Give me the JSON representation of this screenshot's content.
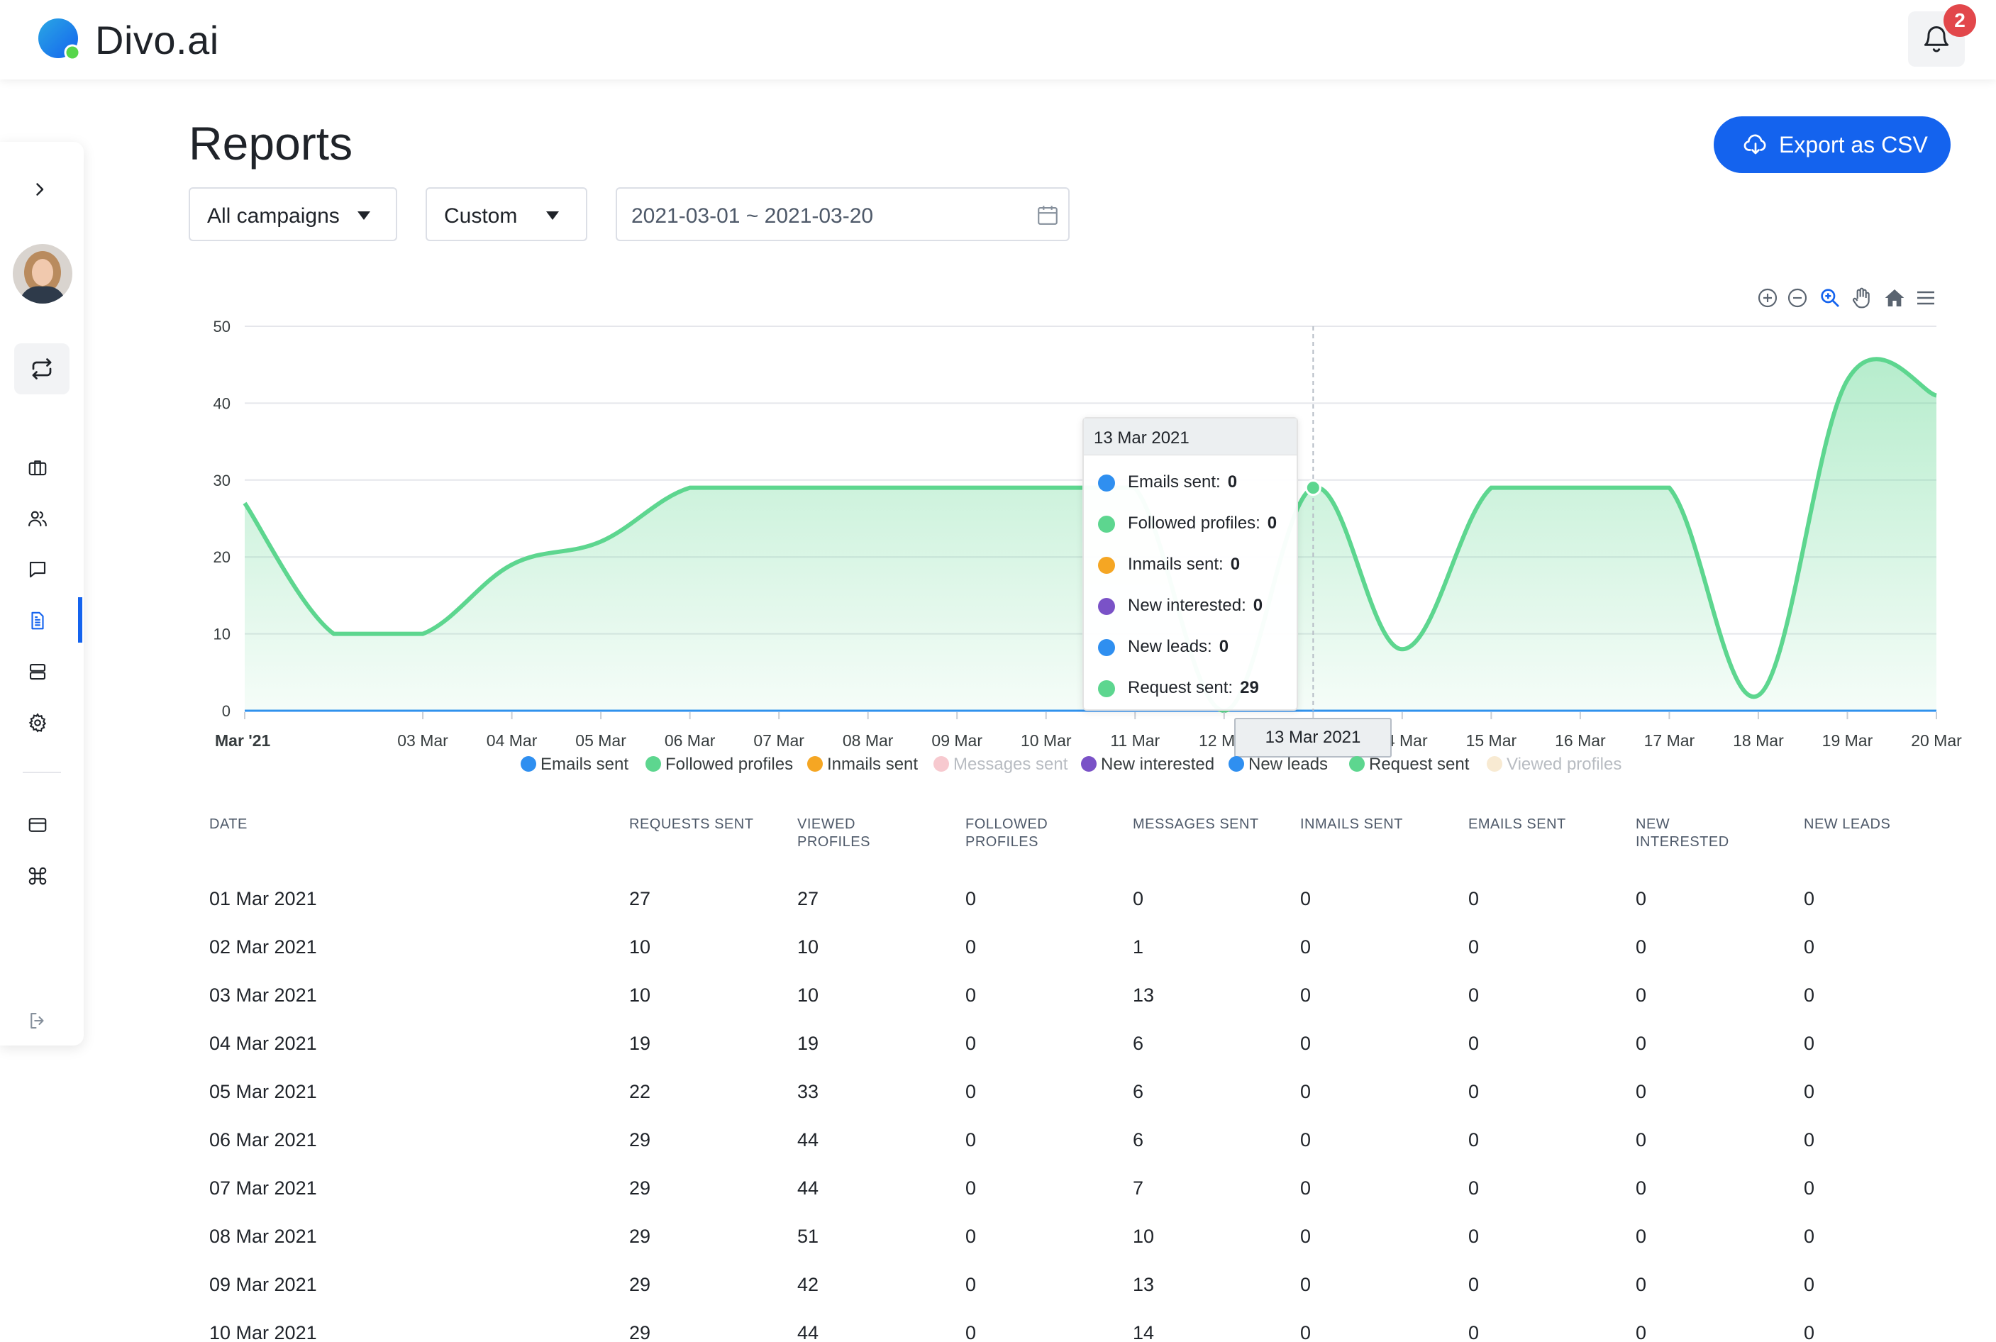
{
  "app": {
    "name": "Divo.ai",
    "notifications": "2"
  },
  "page": {
    "title": "Reports",
    "export_label": "Export as CSV"
  },
  "filters": {
    "campaign": "All campaigns",
    "period": "Custom",
    "date_range": "2021-03-01 ~ 2021-03-20"
  },
  "colors": {
    "accent": "#1463ee",
    "area_green": "#5dd68f",
    "badge_red": "#e2474b"
  },
  "chart_data": {
    "type": "area",
    "x": [
      "01 Mar",
      "02 Mar",
      "03 Mar",
      "04 Mar",
      "05 Mar",
      "06 Mar",
      "07 Mar",
      "08 Mar",
      "09 Mar",
      "10 Mar",
      "11 Mar",
      "12 Mar",
      "13 Mar",
      "14 Mar",
      "15 Mar",
      "16 Mar",
      "17 Mar",
      "18 Mar",
      "19 Mar",
      "20 Mar"
    ],
    "x_tick_labels": [
      "Mar '21",
      "03 Mar",
      "04 Mar",
      "05 Mar",
      "06 Mar",
      "07 Mar",
      "08 Mar",
      "09 Mar",
      "10 Mar",
      "11 Mar",
      "12 Mar",
      "13 Mar",
      "14 Mar",
      "15 Mar",
      "16 Mar",
      "17 Mar",
      "18 Mar",
      "19 Mar",
      "20 Mar"
    ],
    "y_ticks": [
      "0",
      "10",
      "20",
      "30",
      "40",
      "50"
    ],
    "ylim": [
      0,
      50
    ],
    "grid": true,
    "legend_position": "bottom",
    "series": [
      {
        "name": "Emails sent",
        "color": "#2f8ff0",
        "values": [
          0,
          0,
          0,
          0,
          0,
          0,
          0,
          0,
          0,
          0,
          0,
          0,
          0,
          0,
          0,
          0,
          0,
          0,
          0,
          0
        ]
      },
      {
        "name": "Followed profiles",
        "color": "#5dd68f",
        "values": [
          0,
          0,
          0,
          0,
          0,
          0,
          0,
          0,
          0,
          0,
          0,
          0,
          0,
          0,
          0,
          0,
          0,
          0,
          0,
          0
        ]
      },
      {
        "name": "Inmails sent",
        "color": "#f5a623",
        "values": [
          0,
          0,
          0,
          0,
          0,
          0,
          0,
          0,
          0,
          0,
          0,
          0,
          0,
          0,
          0,
          0,
          0,
          0,
          0,
          0
        ]
      },
      {
        "name": "Messages sent",
        "color": "#f7c9cf",
        "values": [
          0,
          1,
          13,
          6,
          6,
          6,
          7,
          10,
          13,
          14,
          0,
          0,
          0,
          0,
          0,
          0,
          0,
          0,
          0,
          0
        ],
        "hidden": true
      },
      {
        "name": "New interested",
        "color": "#7a52c7",
        "values": [
          0,
          0,
          0,
          0,
          0,
          0,
          0,
          0,
          0,
          0,
          0,
          0,
          0,
          0,
          0,
          0,
          0,
          0,
          0,
          0
        ]
      },
      {
        "name": "New leads",
        "color": "#2f8ff0",
        "values": [
          0,
          0,
          0,
          0,
          0,
          0,
          0,
          0,
          0,
          0,
          0,
          0,
          0,
          0,
          0,
          0,
          0,
          0,
          0,
          0
        ]
      },
      {
        "name": "Request sent",
        "color": "#5dd68f",
        "values": [
          27,
          10,
          10,
          19,
          22,
          29,
          29,
          29,
          29,
          29,
          29,
          0,
          29,
          8,
          29,
          29,
          29,
          2,
          43,
          41
        ]
      },
      {
        "name": "Viewed profiles",
        "color": "#f8ead2",
        "values": [
          27,
          10,
          10,
          19,
          33,
          44,
          44,
          51,
          42,
          44,
          0,
          0,
          0,
          0,
          0,
          0,
          0,
          0,
          0,
          0
        ],
        "hidden": true
      }
    ],
    "tooltip": {
      "title": "13 Mar 2021",
      "x_label": "13 Mar 2021",
      "rows": [
        {
          "label": "Emails sent:",
          "value": "0",
          "color": "#2f8ff0"
        },
        {
          "label": "Followed profiles:",
          "value": "0",
          "color": "#5dd68f"
        },
        {
          "label": "Inmails sent:",
          "value": "0",
          "color": "#f5a623"
        },
        {
          "label": "New interested:",
          "value": "0",
          "color": "#7a52c7"
        },
        {
          "label": "New leads:",
          "value": "0",
          "color": "#2f8ff0"
        },
        {
          "label": "Request sent:",
          "value": "29",
          "color": "#5dd68f"
        }
      ]
    }
  },
  "table": {
    "headers": [
      [
        "DATE"
      ],
      [
        "REQUESTS SENT"
      ],
      [
        "VIEWED",
        "PROFILES"
      ],
      [
        "FOLLOWED",
        "PROFILES"
      ],
      [
        "MESSAGES SENT"
      ],
      [
        "INMAILS SENT"
      ],
      [
        "EMAILS SENT"
      ],
      [
        "NEW",
        "INTERESTED"
      ],
      [
        "NEW LEADS"
      ]
    ],
    "rows": [
      [
        "01 Mar 2021",
        "27",
        "27",
        "0",
        "0",
        "0",
        "0",
        "0",
        "0"
      ],
      [
        "02 Mar 2021",
        "10",
        "10",
        "0",
        "1",
        "0",
        "0",
        "0",
        "0"
      ],
      [
        "03 Mar 2021",
        "10",
        "10",
        "0",
        "13",
        "0",
        "0",
        "0",
        "0"
      ],
      [
        "04 Mar 2021",
        "19",
        "19",
        "0",
        "6",
        "0",
        "0",
        "0",
        "0"
      ],
      [
        "05 Mar 2021",
        "22",
        "33",
        "0",
        "6",
        "0",
        "0",
        "0",
        "0"
      ],
      [
        "06 Mar 2021",
        "29",
        "44",
        "0",
        "6",
        "0",
        "0",
        "0",
        "0"
      ],
      [
        "07 Mar 2021",
        "29",
        "44",
        "0",
        "7",
        "0",
        "0",
        "0",
        "0"
      ],
      [
        "08 Mar 2021",
        "29",
        "51",
        "0",
        "10",
        "0",
        "0",
        "0",
        "0"
      ],
      [
        "09 Mar 2021",
        "29",
        "42",
        "0",
        "13",
        "0",
        "0",
        "0",
        "0"
      ],
      [
        "10 Mar 2021",
        "29",
        "44",
        "0",
        "14",
        "0",
        "0",
        "0",
        "0"
      ]
    ]
  }
}
